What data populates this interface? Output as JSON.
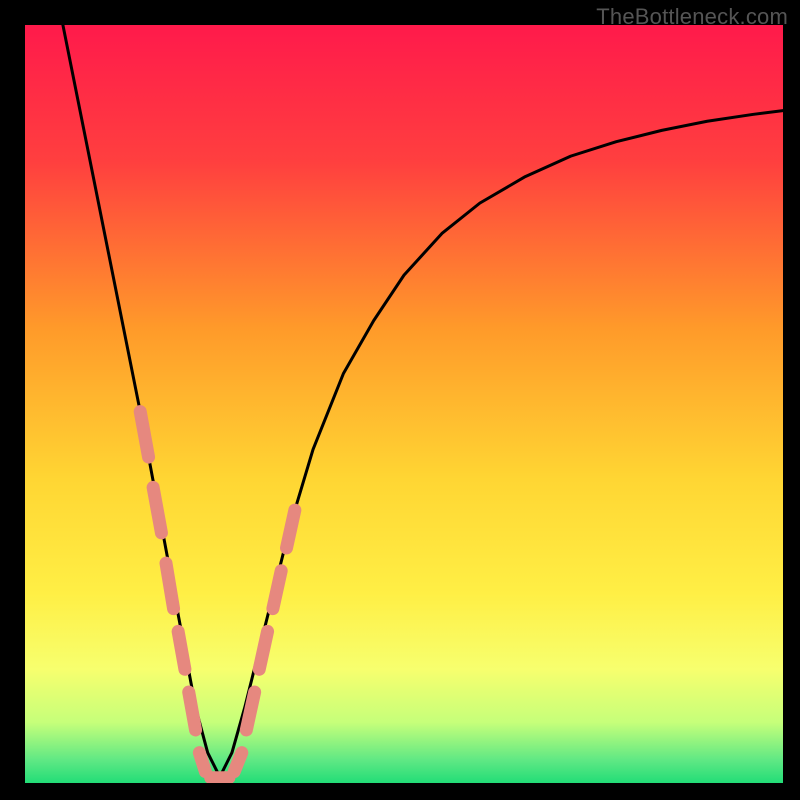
{
  "watermark": "TheBottleneck.com",
  "chart_data": {
    "type": "line",
    "title": "",
    "xlabel": "",
    "ylabel": "",
    "xlim": [
      0,
      100
    ],
    "ylim": [
      0,
      100
    ],
    "gradient_stops": [
      {
        "offset": 0,
        "color": "#ff1a4b"
      },
      {
        "offset": 18,
        "color": "#ff3f3f"
      },
      {
        "offset": 40,
        "color": "#ff9a2a"
      },
      {
        "offset": 60,
        "color": "#ffd633"
      },
      {
        "offset": 75,
        "color": "#ffef45"
      },
      {
        "offset": 85,
        "color": "#f7ff6e"
      },
      {
        "offset": 92,
        "color": "#c6ff7a"
      },
      {
        "offset": 97,
        "color": "#5fe884"
      },
      {
        "offset": 100,
        "color": "#22dd77"
      }
    ],
    "series": [
      {
        "name": "curve",
        "x": [
          5,
          7,
          9,
          11,
          13,
          15,
          16.5,
          18,
          19.5,
          21,
          22.5,
          24.1,
          25.7,
          27.3,
          29,
          31,
          33,
          35,
          38,
          42,
          46,
          50,
          55,
          60,
          66,
          72,
          78,
          84,
          90,
          96,
          100
        ],
        "values": [
          100,
          90,
          80,
          70,
          60,
          50,
          42,
          34,
          26,
          18,
          10,
          4,
          0.8,
          4,
          10,
          18,
          26,
          34,
          44,
          54,
          61,
          67,
          72.5,
          76.5,
          80,
          82.7,
          84.6,
          86.1,
          87.3,
          88.2,
          88.7
        ]
      }
    ],
    "markers": {
      "name": "dashed-region",
      "color": "#e6887f",
      "segments": [
        {
          "x1": 15.2,
          "y1": 49,
          "x2": 16.3,
          "y2": 43
        },
        {
          "x1": 16.9,
          "y1": 39,
          "x2": 18.0,
          "y2": 33
        },
        {
          "x1": 18.6,
          "y1": 29,
          "x2": 19.6,
          "y2": 23
        },
        {
          "x1": 20.2,
          "y1": 20,
          "x2": 21.1,
          "y2": 15
        },
        {
          "x1": 21.6,
          "y1": 12,
          "x2": 22.5,
          "y2": 7
        },
        {
          "x1": 23.0,
          "y1": 4,
          "x2": 23.8,
          "y2": 1.5
        },
        {
          "x1": 24.5,
          "y1": 0.7,
          "x2": 26.9,
          "y2": 0.7
        },
        {
          "x1": 27.6,
          "y1": 1.5,
          "x2": 28.6,
          "y2": 4
        },
        {
          "x1": 29.2,
          "y1": 7,
          "x2": 30.3,
          "y2": 12
        },
        {
          "x1": 30.9,
          "y1": 15,
          "x2": 32.0,
          "y2": 20
        },
        {
          "x1": 32.7,
          "y1": 23,
          "x2": 33.8,
          "y2": 28
        },
        {
          "x1": 34.5,
          "y1": 31,
          "x2": 35.6,
          "y2": 36
        }
      ]
    }
  }
}
